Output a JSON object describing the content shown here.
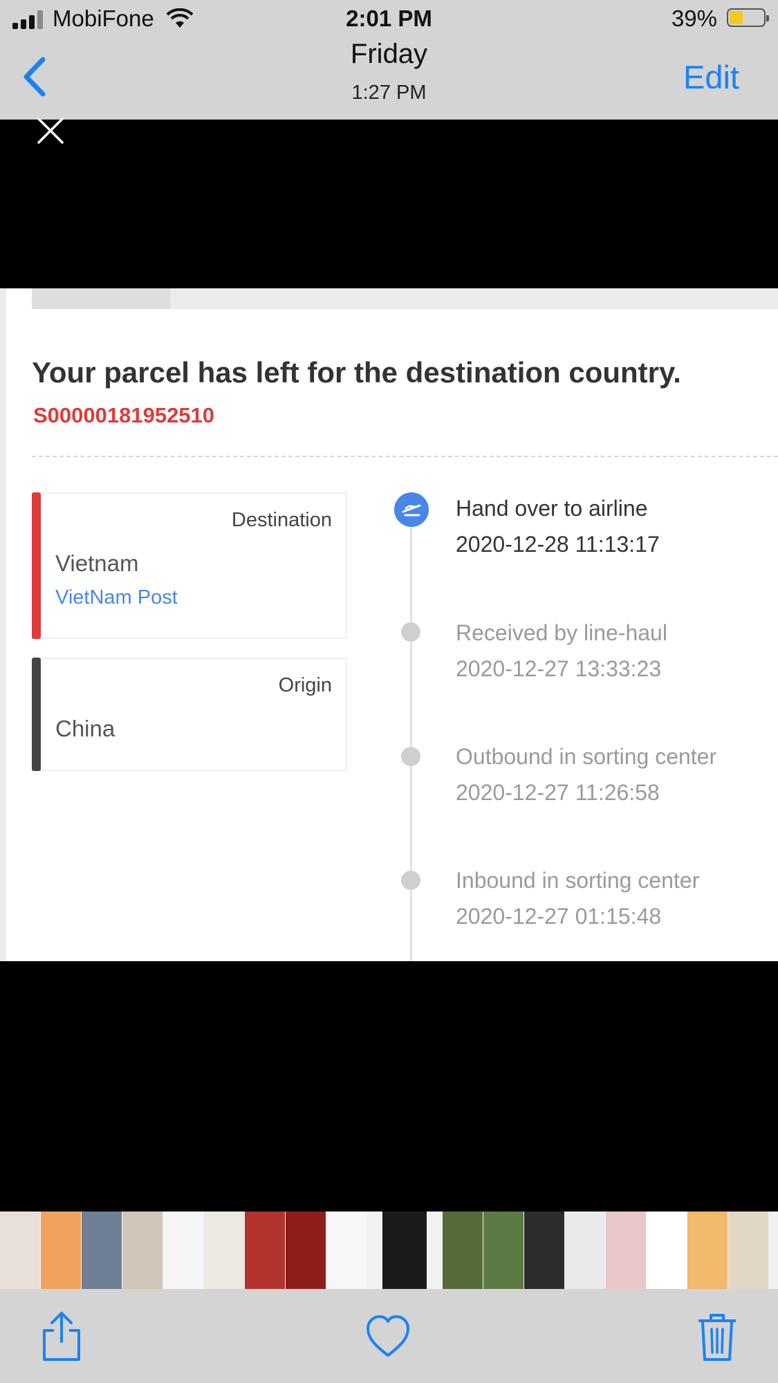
{
  "status_bar": {
    "carrier": "MobiFone",
    "time": "2:01 PM",
    "battery_percent": "39%",
    "battery_level": 0.39,
    "battery_color": "#f4c81c"
  },
  "nav_bar": {
    "title": "Friday",
    "subtitle": "1:27 PM",
    "edit_label": "Edit",
    "accent_color": "#1a82f6"
  },
  "viewer": {
    "close_icon": "close-icon",
    "headline": "Your parcel has left for the destination country.",
    "tracking_number": "S00000181952510",
    "destination": {
      "tag": "Destination",
      "country": "Vietnam",
      "carrier": "VietNam Post",
      "accent": "#e03a3a"
    },
    "origin": {
      "tag": "Origin",
      "country": "China",
      "accent": "#444444"
    },
    "timeline": [
      {
        "title": "Hand over to airline",
        "time": "2020-12-28 11:13:17",
        "active": true,
        "icon": "airplane-icon"
      },
      {
        "title": "Received by line-haul",
        "time": "2020-12-27 13:33:23",
        "active": false
      },
      {
        "title": "Outbound in sorting center",
        "time": "2020-12-27 11:26:58",
        "active": false
      },
      {
        "title": "Inbound in sorting center",
        "time": "2020-12-27 01:15:48",
        "active": false
      }
    ]
  },
  "thumbnail_strip": {
    "count": 19
  },
  "toolbar": {
    "share_icon": "share-icon",
    "favorite_icon": "heart-icon",
    "delete_icon": "trash-icon"
  }
}
